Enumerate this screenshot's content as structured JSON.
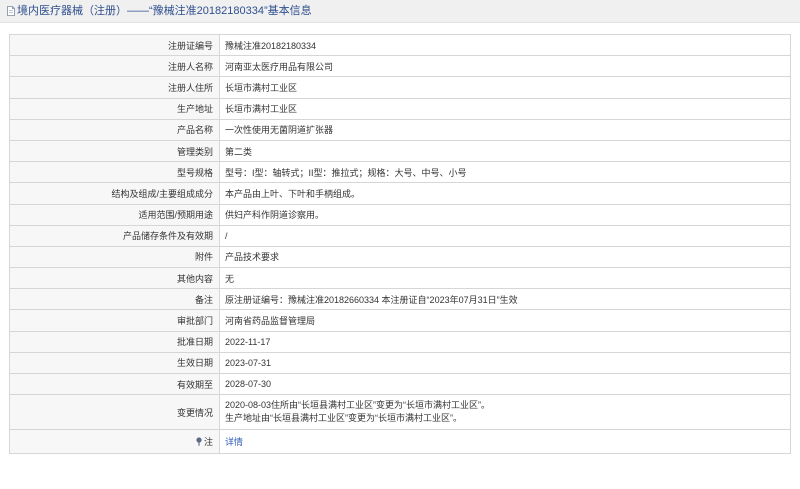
{
  "header": {
    "title": "境内医疗器械（注册）——“豫械注准20182180334”基本信息"
  },
  "table": {
    "rows": [
      {
        "label": "注册证编号",
        "value": "豫械注准20182180334"
      },
      {
        "label": "注册人名称",
        "value": "河南亚太医疗用品有限公司"
      },
      {
        "label": "注册人住所",
        "value": "长垣市满村工业区"
      },
      {
        "label": "生产地址",
        "value": "长垣市满村工业区"
      },
      {
        "label": "产品名称",
        "value": "一次性使用无菌阴道扩张器"
      },
      {
        "label": "管理类别",
        "value": "第二类"
      },
      {
        "label": "型号规格",
        "value": "型号：I型：轴转式；II型：推拉式；规格：大号、中号、小号"
      },
      {
        "label": "结构及组成/主要组成成分",
        "value": "本产品由上叶、下叶和手柄组成。"
      },
      {
        "label": "适用范围/预期用途",
        "value": "供妇产科作阴道诊察用。"
      },
      {
        "label": "产品储存条件及有效期",
        "value": "/"
      },
      {
        "label": "附件",
        "value": "产品技术要求"
      },
      {
        "label": "其他内容",
        "value": "无"
      },
      {
        "label": "备注",
        "value": "原注册证编号：豫械注准20182660334 本注册证自“2023年07月31日”生效"
      },
      {
        "label": "审批部门",
        "value": "河南省药品监督管理局"
      },
      {
        "label": "批准日期",
        "value": "2022-11-17"
      },
      {
        "label": "生效日期",
        "value": "2023-07-31"
      },
      {
        "label": "有效期至",
        "value": "2028-07-30"
      }
    ],
    "change": {
      "label": "变更情况",
      "line1": "2020-08-03住所由“长垣县满村工业区”变更为“长垣市满村工业区”。",
      "line2": "生产地址由“长垣县满村工业区”变更为“长垣市满村工业区”。"
    },
    "note": {
      "label": "注",
      "link": "详情"
    }
  },
  "colors": {
    "header_bg": "#f0f0f0",
    "title": "#2f4f8f",
    "link": "#2f5db8",
    "border": "#d6d6d6"
  }
}
